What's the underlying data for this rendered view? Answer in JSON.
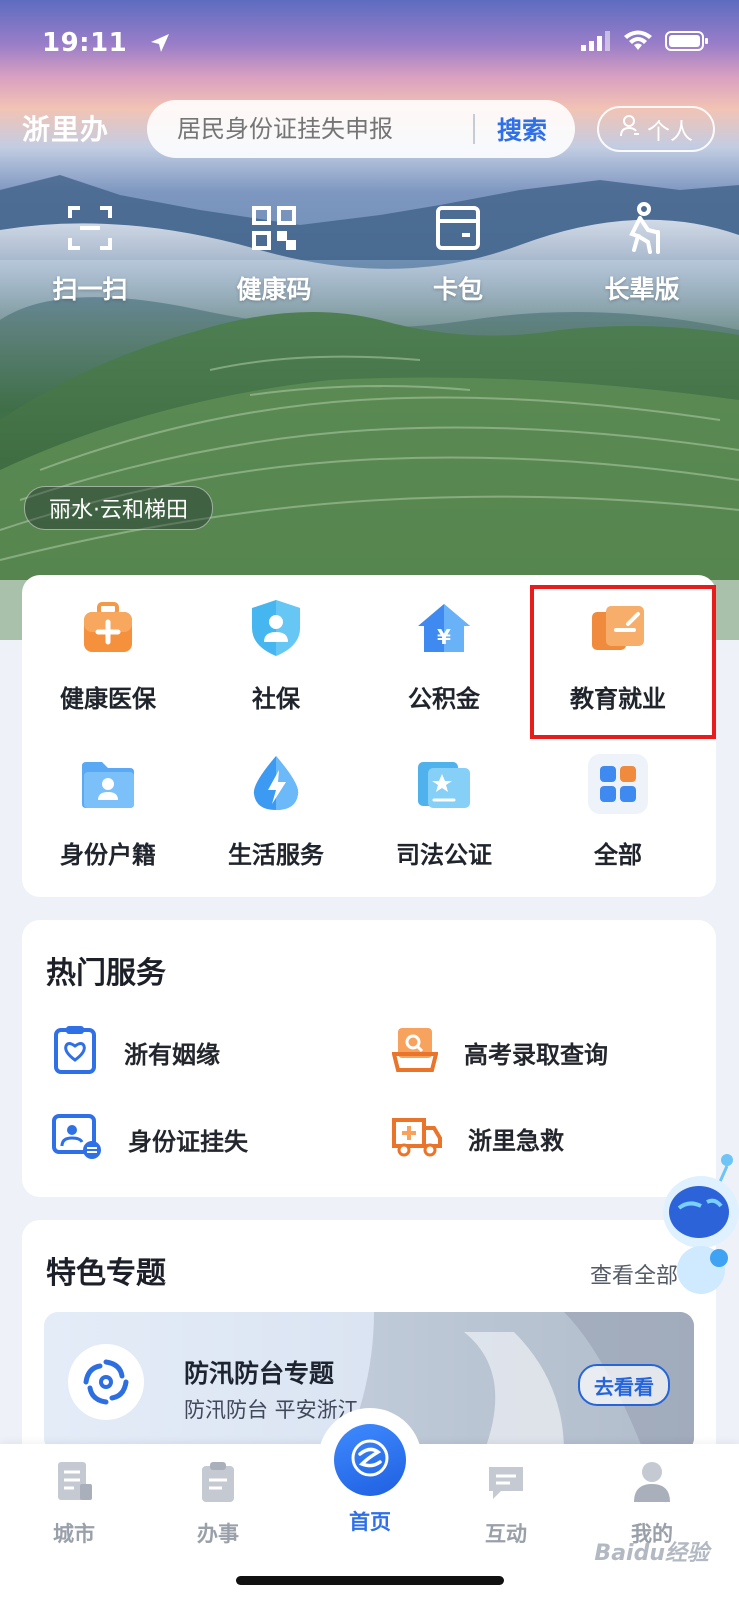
{
  "status_bar": {
    "time": "19:11"
  },
  "header": {
    "brand": "浙里办",
    "search_placeholder": "居民身份证挂失申报",
    "search_button": "搜索",
    "personal_button": "个人"
  },
  "quick_actions": [
    {
      "label": "扫一扫",
      "icon": "scan-icon"
    },
    {
      "label": "健康码",
      "icon": "qr-code-icon"
    },
    {
      "label": "卡包",
      "icon": "card-wallet-icon"
    },
    {
      "label": "长辈版",
      "icon": "elder-icon"
    }
  ],
  "location_tag": "丽水·云和梯田",
  "categories": [
    {
      "label": "健康医保",
      "icon": "medical-kit-icon"
    },
    {
      "label": "社保",
      "icon": "shield-person-icon"
    },
    {
      "label": "公积金",
      "icon": "house-yen-icon"
    },
    {
      "label": "教育就业",
      "icon": "education-icon"
    },
    {
      "label": "身份户籍",
      "icon": "id-folder-icon"
    },
    {
      "label": "生活服务",
      "icon": "lightning-drop-icon"
    },
    {
      "label": "司法公证",
      "icon": "justice-folder-icon"
    },
    {
      "label": "全部",
      "icon": "grid-icon"
    }
  ],
  "hot_services": {
    "title": "热门服务",
    "items": [
      {
        "label": "浙有姻缘",
        "icon": "marriage-certificate-icon"
      },
      {
        "label": "高考录取查询",
        "icon": "exam-search-icon"
      },
      {
        "label": "身份证挂失",
        "icon": "id-card-icon"
      },
      {
        "label": "浙里急救",
        "icon": "ambulance-icon"
      }
    ]
  },
  "featured": {
    "title": "特色专题",
    "see_all": "查看全部",
    "banner": {
      "title": "防汛防台专题",
      "subtitle": "防汛防台 平安浙江",
      "button": "去看看"
    }
  },
  "tabbar": {
    "items": [
      {
        "label": "城市",
        "icon": "city-icon"
      },
      {
        "label": "办事",
        "icon": "clipboard-icon"
      },
      {
        "label": "首页",
        "icon": "home-logo-icon"
      },
      {
        "label": "互动",
        "icon": "chat-icon"
      },
      {
        "label": "我的",
        "icon": "person-icon"
      }
    ],
    "active": "首页"
  },
  "watermark": "Baidu经验",
  "colors": {
    "accent": "#2f6fe8",
    "highlight": "#e81c1c",
    "orange": "#f08a3c"
  }
}
